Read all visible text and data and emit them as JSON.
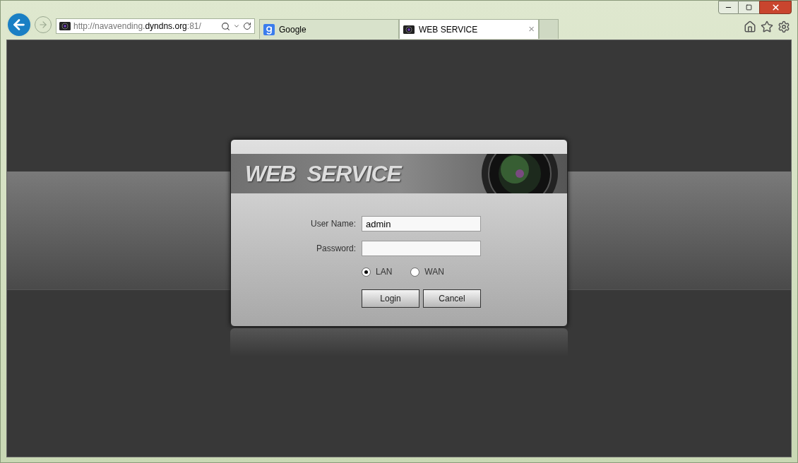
{
  "address_bar": {
    "url_prefix": "http://navavending.",
    "url_domain": "dyndns.org",
    "url_suffix": ":81/"
  },
  "tabs": [
    {
      "label": "Google",
      "kind": "google",
      "selected": false
    },
    {
      "label": "WEB SERVICE",
      "kind": "camera",
      "selected": true,
      "close": "×"
    }
  ],
  "login": {
    "banner_title": "WEB  SERVICE",
    "fields": [
      {
        "label": "User Name:",
        "value": "admin"
      },
      {
        "label": "Password:"
      }
    ],
    "network": [
      {
        "label": "LAN",
        "selected": true
      },
      {
        "label": "WAN",
        "selected": false
      }
    ],
    "buttons": [
      "Login",
      "Cancel"
    ]
  }
}
